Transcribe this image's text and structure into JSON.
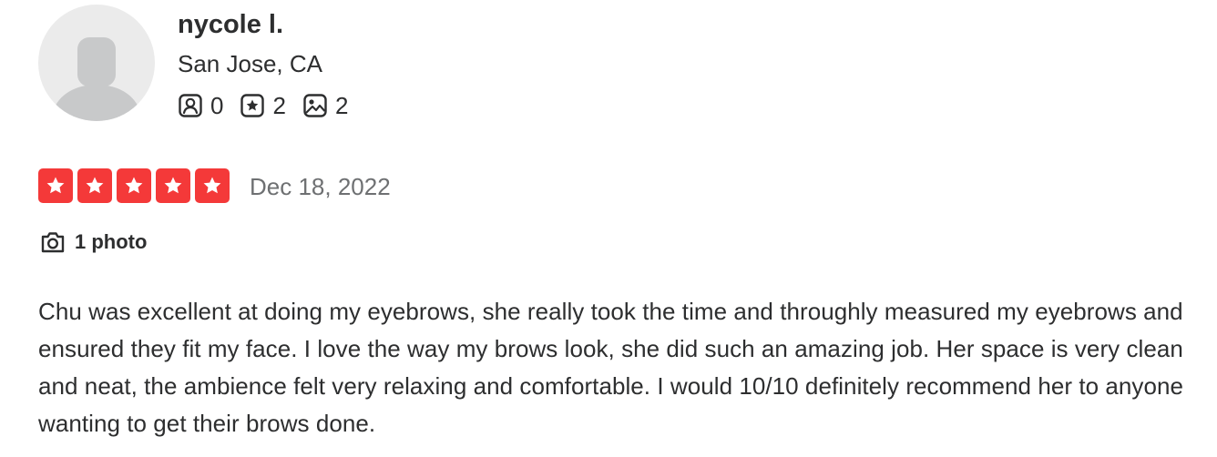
{
  "user": {
    "name": "nycole l.",
    "location": "San Jose, CA",
    "avatar_icon": "default-user-avatar-icon",
    "stats": [
      {
        "icon": "friends-icon",
        "value": "0"
      },
      {
        "icon": "reviews-star-icon",
        "value": "2"
      },
      {
        "icon": "photos-icon",
        "value": "2"
      }
    ]
  },
  "review": {
    "rating": 5,
    "rating_max": 5,
    "star_color": "#f43939",
    "date": "Dec 18, 2022",
    "photo_icon": "camera-icon",
    "photo_count_label": "1 photo",
    "text": "Chu was excellent at doing my eyebrows, she really took the time and throughly measured my eyebrows and ensured they fit my face. I love the way my brows look, she did such an amazing job. Her space is very clean and neat, the ambience felt very relaxing and comfortable. I would 10/10 definitely recommend her to anyone wanting to get their brows done."
  },
  "colors": {
    "text_primary": "#2d2e2f",
    "text_secondary": "#6e7072",
    "avatar_bg": "#ebebeb",
    "avatar_fg": "#c8c9ca"
  }
}
